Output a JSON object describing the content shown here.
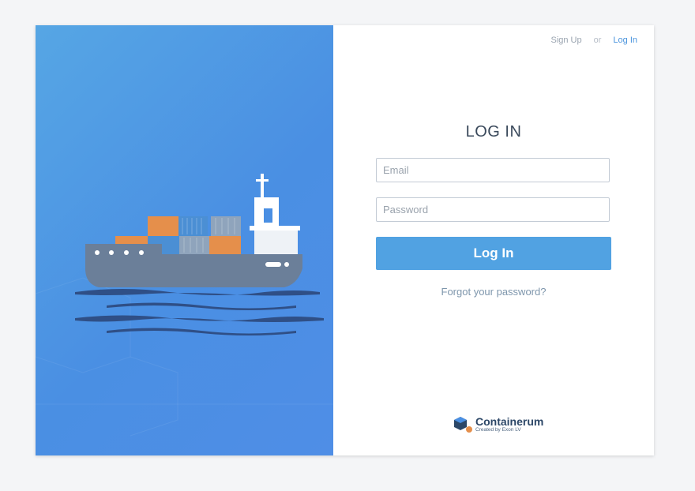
{
  "nav": {
    "signup_label": "Sign Up",
    "or_label": "or",
    "login_label": "Log In"
  },
  "form": {
    "title": "LOG IN",
    "email_placeholder": "Email",
    "password_placeholder": "Password",
    "submit_label": "Log In",
    "forgot_label": "Forgot your password?"
  },
  "brand": {
    "name": "Containerum",
    "tagline": "Created by Exon LV"
  },
  "colors": {
    "hero_bg": "#4f8ee6",
    "button_bg": "#51a2e2",
    "link": "#4a94dd",
    "ship_hull": "#6b7f99",
    "container_orange": "#e58f4b"
  }
}
